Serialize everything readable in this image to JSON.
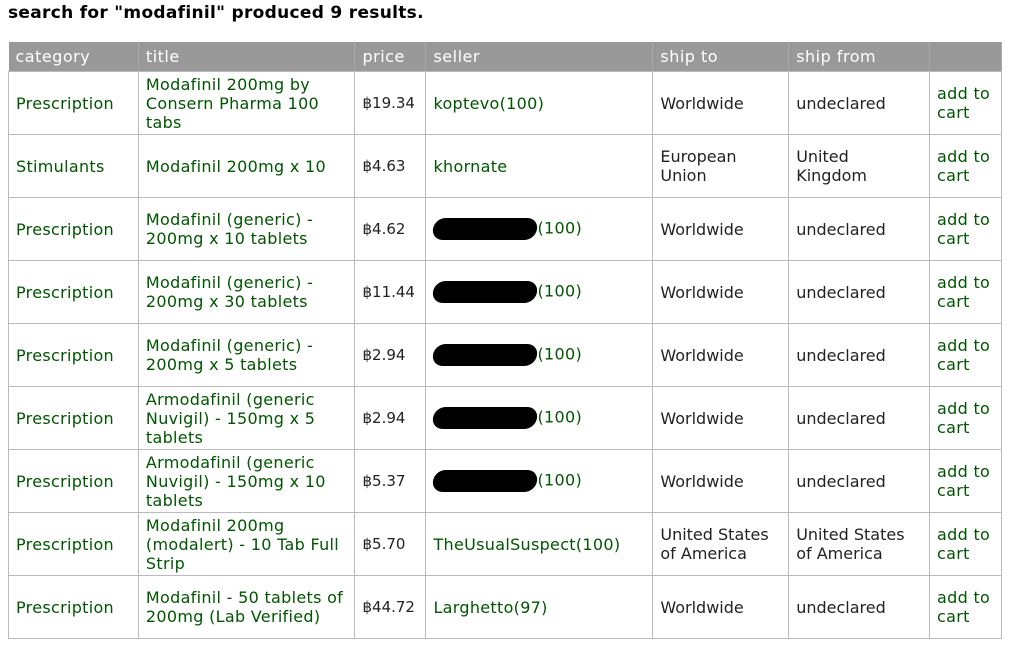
{
  "heading": "search for \"modafinil\" produced 9 results.",
  "columns": [
    "category",
    "title",
    "price",
    "seller",
    "ship to",
    "ship from",
    ""
  ],
  "rows": [
    {
      "category": "Prescription",
      "title": "Modafinil 200mg by Consern Pharma 100 tabs",
      "price": "฿19.34",
      "seller": "koptevo(100)",
      "redacted": false,
      "ship_to": "Worldwide",
      "ship_from": "undeclared",
      "action": "add to cart"
    },
    {
      "category": "Stimulants",
      "title": "Modafinil 200mg x 10",
      "price": "฿4.63",
      "seller": "khornate",
      "redacted": false,
      "ship_to": "European Union",
      "ship_from": "United Kingdom",
      "action": "add to cart"
    },
    {
      "category": "Prescription",
      "title": "Modafinil (generic) - 200mg x 10 tablets",
      "price": "฿4.62",
      "seller": "(100)",
      "redacted": true,
      "ship_to": "Worldwide",
      "ship_from": "undeclared",
      "action": "add to cart"
    },
    {
      "category": "Prescription",
      "title": "Modafinil (generic) - 200mg x 30 tablets",
      "price": "฿11.44",
      "seller": "(100)",
      "redacted": true,
      "ship_to": "Worldwide",
      "ship_from": "undeclared",
      "action": "add to cart"
    },
    {
      "category": "Prescription",
      "title": "Modafinil (generic) - 200mg x 5 tablets",
      "price": "฿2.94",
      "seller": "(100)",
      "redacted": true,
      "ship_to": "Worldwide",
      "ship_from": "undeclared",
      "action": "add to cart"
    },
    {
      "category": "Prescription",
      "title": "Armodafinil (generic Nuvigil) - 150mg x 5 tablets",
      "price": "฿2.94",
      "seller": "(100)",
      "redacted": true,
      "ship_to": "Worldwide",
      "ship_from": "undeclared",
      "action": "add to cart"
    },
    {
      "category": "Prescription",
      "title": "Armodafinil (generic Nuvigil) - 150mg x 10 tablets",
      "price": "฿5.37",
      "seller": "(100)",
      "redacted": true,
      "ship_to": "Worldwide",
      "ship_from": "undeclared",
      "action": "add to cart"
    },
    {
      "category": "Prescription",
      "title": "Modafinil 200mg (modalert) - 10 Tab Full Strip",
      "price": "฿5.70",
      "seller": "TheUsualSuspect(100)",
      "redacted": false,
      "ship_to": "United States of America",
      "ship_from": "United States of America",
      "action": "add to cart"
    },
    {
      "category": "Prescription",
      "title": "Modafinil - 50 tablets of 200mg (Lab Verified)",
      "price": "฿44.72",
      "seller": "Larghetto(97)",
      "redacted": false,
      "ship_to": "Worldwide",
      "ship_from": "undeclared",
      "action": "add to cart"
    }
  ],
  "colors": {
    "header_bg": "#999999",
    "link_green": "#005500"
  }
}
